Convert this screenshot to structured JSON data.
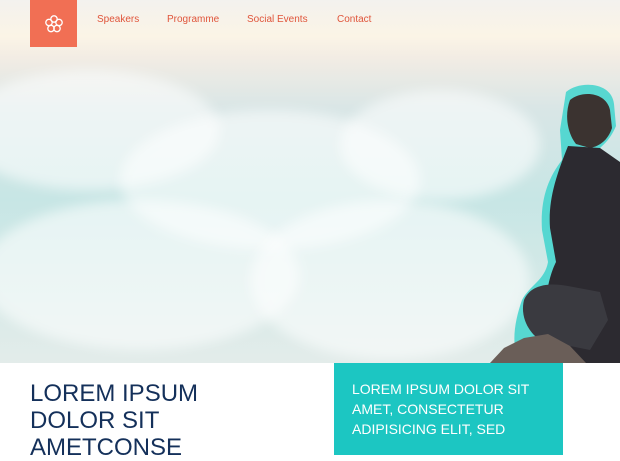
{
  "nav": {
    "logo_icon": "flower-icon",
    "links": [
      {
        "label": "Speakers"
      },
      {
        "label": "Programme"
      },
      {
        "label": "Social Events"
      },
      {
        "label": "Contact"
      }
    ]
  },
  "hero": {
    "image": "sea-of-clouds-with-person-sitting"
  },
  "content": {
    "headline": "LOREM IPSUM DOLOR SIT AMETCONSE",
    "callout": "LOREM IPSUM DOLOR SIT AMET, CONSECTETUR ADIPISICING ELIT, SED"
  },
  "colors": {
    "accent": "#f16f54",
    "nav_text": "#e0553b",
    "teal": "#1cc6c2",
    "headline": "#14305a"
  }
}
